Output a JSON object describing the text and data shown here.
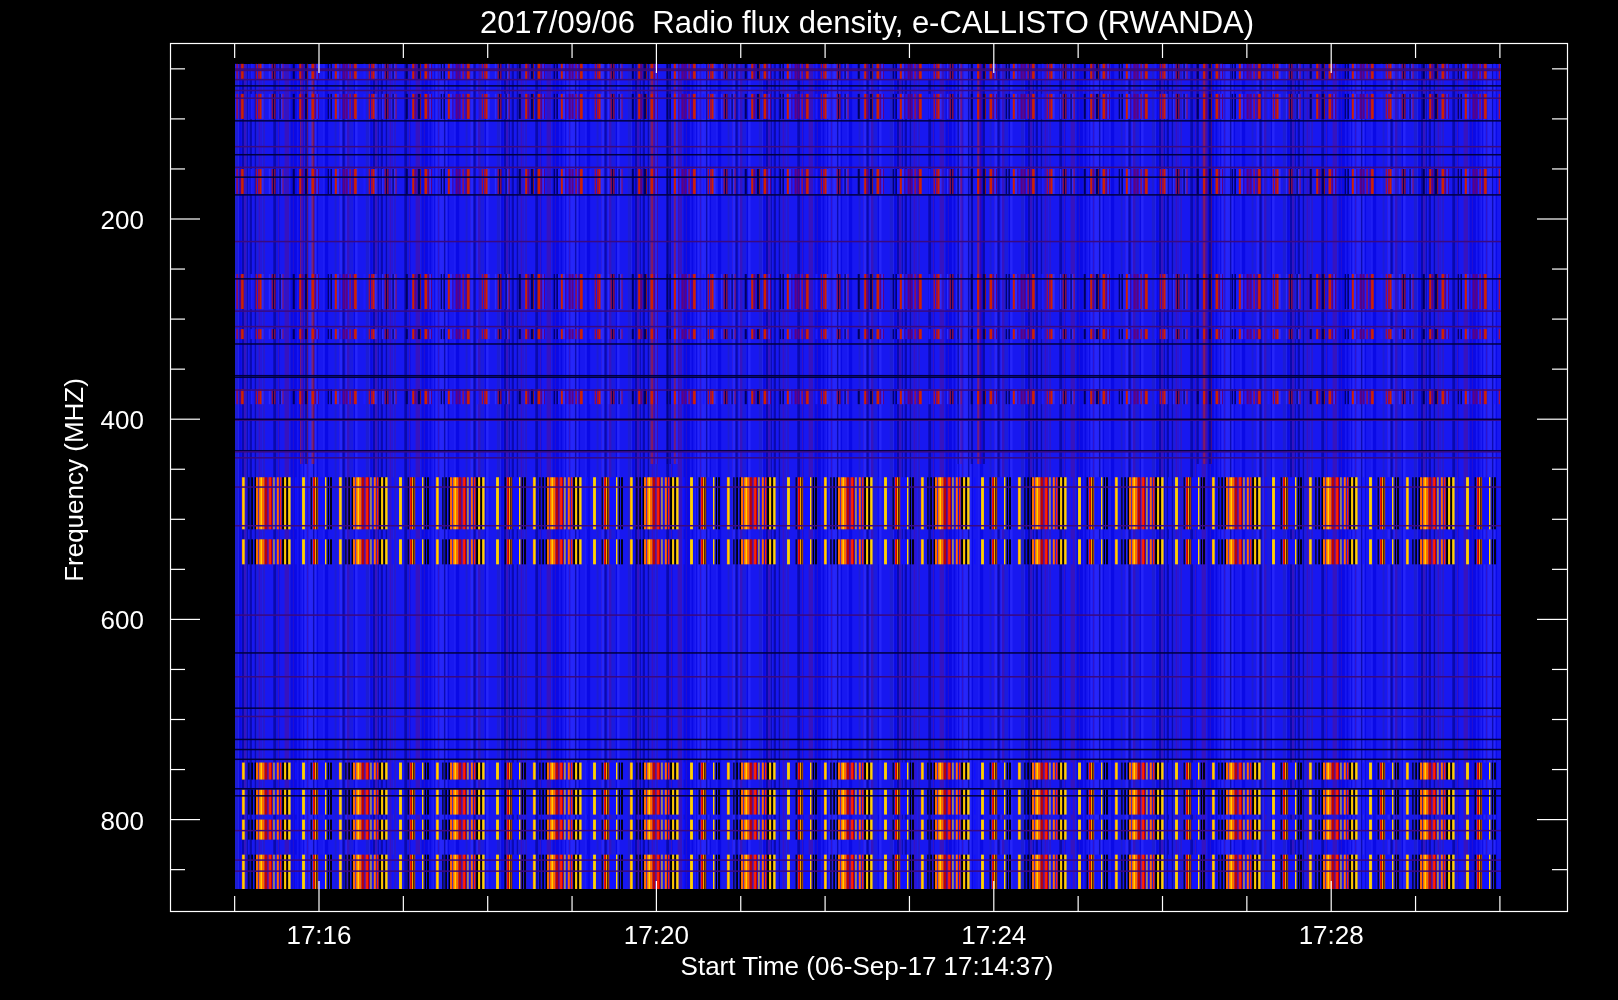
{
  "title": "2017/09/06  Radio flux density, e-CALLISTO (RWANDA)",
  "x_axis": {
    "label": "Start Time (06-Sep-17 17:14:37)",
    "ticks": [
      "17:16",
      "17:20",
      "17:24",
      "17:28"
    ]
  },
  "y_axis": {
    "label": "Frequency (MHZ)",
    "ticks": [
      "200",
      "400",
      "600",
      "800"
    ]
  }
}
